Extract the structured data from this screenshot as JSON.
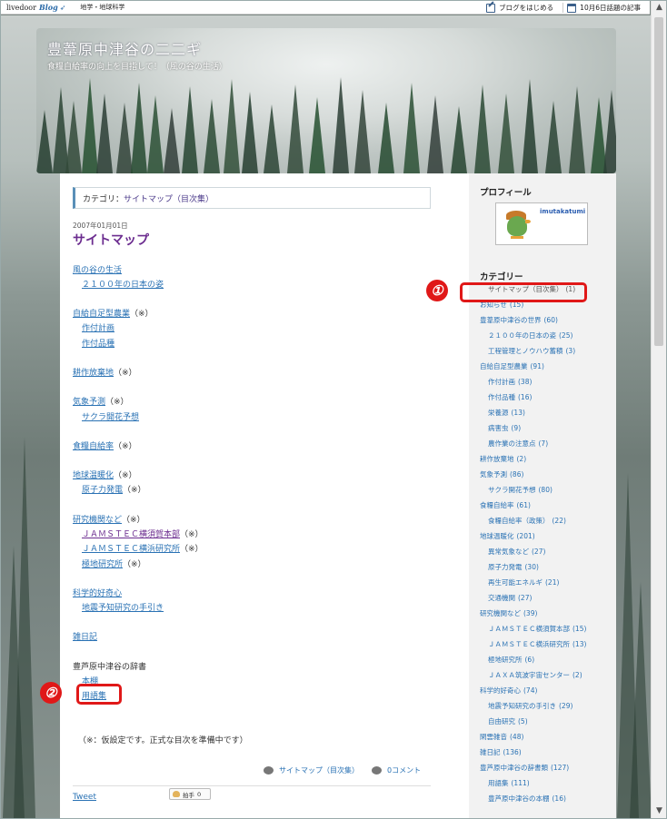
{
  "topbar": {
    "logo": "livedoor",
    "logo_blog": "Blog",
    "category": "地学・地球科学",
    "start_blog": "ブログをはじめる",
    "topic": "10月6日話題の記事"
  },
  "header": {
    "title": "豊葦原中津谷の二二ギ",
    "description": "食糧自給率の向上を目指して！（風の谷の生活）"
  },
  "main": {
    "category_prefix": "カテゴリ：",
    "category_name": "サイトマップ（目次集）",
    "date": "2007年01月01日",
    "title": "サイトマップ",
    "items": [
      {
        "text": "風の谷の生活",
        "link": true
      },
      {
        "text": "２１００年の日本の姿",
        "link": true
      },
      {
        "text": "自給自足型農業",
        "link": true,
        "suffix": "（※）"
      },
      {
        "text": "作付計画",
        "link": true
      },
      {
        "text": "作付品種",
        "link": true
      },
      {
        "text": "耕作放棄地",
        "link": true,
        "suffix": "（※）"
      },
      {
        "text": "気象予測",
        "link": true,
        "suffix": "（※）"
      },
      {
        "text": "サクラ開花予想",
        "link": true
      },
      {
        "text": "食糧自給率",
        "link": true,
        "suffix": "（※）"
      },
      {
        "text": "地球温暖化",
        "link": true,
        "suffix": "（※）"
      },
      {
        "text": "原子力発電",
        "link": true,
        "suffix": "（※）"
      },
      {
        "text": "研究機関など",
        "link": true,
        "suffix": "（※）"
      },
      {
        "text": "ＪＡＭＳＴＥＣ横須賀本部",
        "link": true,
        "suffix": "（※）"
      },
      {
        "text": "ＪＡＭＳＴＥＣ横浜研究所",
        "link": true,
        "suffix": "（※）"
      },
      {
        "text": "極地研究所",
        "link": true,
        "suffix": "（※）"
      },
      {
        "text": "科学的好奇心",
        "link": true
      },
      {
        "text": "地震予知研究の手引き",
        "link": true
      },
      {
        "text": "雑日記",
        "link": true
      },
      {
        "text": "豊芦原中津谷の辞書",
        "link": false
      },
      {
        "text": "本棚",
        "link": true
      },
      {
        "text": "用語集",
        "link": true
      }
    ],
    "note": "（※：仮設定です。正式な目次を準備中です）",
    "footer_category": "サイトマップ（目次集）",
    "footer_comment": "0コメント",
    "tweet": "Tweet",
    "clap": "拍手",
    "clap_count": "0"
  },
  "sidebar": {
    "profile_heading": "プロフィール",
    "profile_name": "imutakatumi",
    "category_heading": "カテゴリー",
    "categories": [
      {
        "label": "サイトマップ（目次集）",
        "count": "(1)"
      },
      {
        "label": "お知らせ",
        "count": "(15)"
      },
      {
        "label": "豊葦原中津谷の世界",
        "count": "(60)"
      },
      {
        "label": "２１００年の日本の姿",
        "count": "(25)"
      },
      {
        "label": "工程管理とノウハウ蓄積",
        "count": "(3)"
      },
      {
        "label": "自給自足型農業",
        "count": "(91)"
      },
      {
        "label": "作付計画",
        "count": "(38)"
      },
      {
        "label": "作付品種",
        "count": "(16)"
      },
      {
        "label": "栄養源",
        "count": "(13)"
      },
      {
        "label": "病害虫",
        "count": "(9)"
      },
      {
        "label": "農作業の注意点",
        "count": "(7)"
      },
      {
        "label": "耕作放棄地",
        "count": "(2)"
      },
      {
        "label": "気象予測",
        "count": "(86)"
      },
      {
        "label": "サクラ開花予想",
        "count": "(80)"
      },
      {
        "label": "食糧自給率",
        "count": "(61)"
      },
      {
        "label": "食糧自給率（政策）",
        "count": "(22)"
      },
      {
        "label": "地球温暖化",
        "count": "(201)"
      },
      {
        "label": "異常気象など",
        "count": "(27)"
      },
      {
        "label": "原子力発電",
        "count": "(30)"
      },
      {
        "label": "再生可能エネルギ",
        "count": "(21)"
      },
      {
        "label": "交通機関",
        "count": "(27)"
      },
      {
        "label": "研究機関など",
        "count": "(39)"
      },
      {
        "label": "ＪＡＭＳＴＥＣ横須賀本部",
        "count": "(15)"
      },
      {
        "label": "ＪＡＭＳＴＥＣ横浜研究所",
        "count": "(13)"
      },
      {
        "label": "極地研究所",
        "count": "(6)"
      },
      {
        "label": "ＪＡＸＡ筑波宇宙センター",
        "count": "(2)"
      },
      {
        "label": "科学的好奇心",
        "count": "(74)"
      },
      {
        "label": "地震予知研究の手引き",
        "count": "(29)"
      },
      {
        "label": "自由研究",
        "count": "(5)"
      },
      {
        "label": "閑雲雑音",
        "count": "(48)"
      },
      {
        "label": "雑日記",
        "count": "(136)"
      },
      {
        "label": "豊芦原中津谷の辞書類",
        "count": "(127)"
      },
      {
        "label": "用語集",
        "count": "(111)"
      },
      {
        "label": "豊芦原中津谷の本棚",
        "count": "(16)"
      }
    ]
  },
  "annotations": {
    "mark1": "①",
    "mark2": "②"
  },
  "colors": {
    "link": "#2a72b4",
    "title_purple": "#6b2c8f",
    "annotation_red": "#e01818"
  }
}
